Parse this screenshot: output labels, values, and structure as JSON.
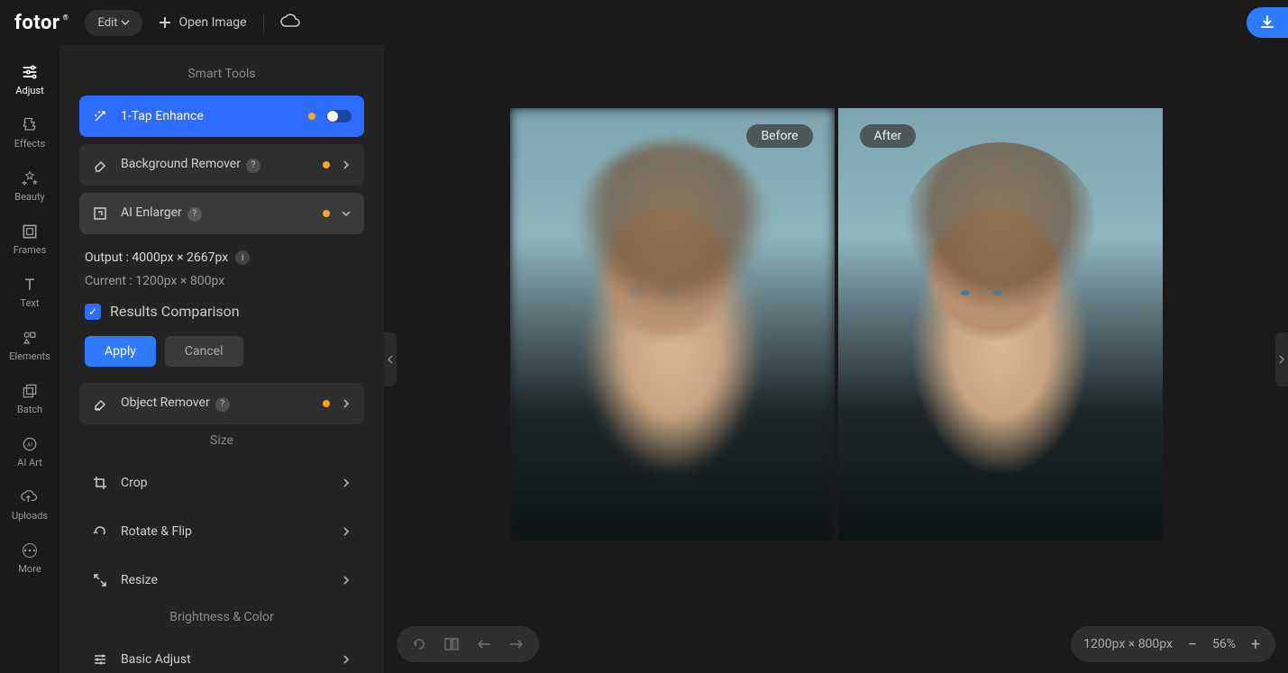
{
  "header": {
    "logo_text": "fotor",
    "edit_label": "Edit",
    "open_image_label": "Open Image"
  },
  "nav": {
    "items": [
      {
        "label": "Adjust"
      },
      {
        "label": "Effects"
      },
      {
        "label": "Beauty"
      },
      {
        "label": "Frames"
      },
      {
        "label": "Text"
      },
      {
        "label": "Elements"
      },
      {
        "label": "Batch"
      },
      {
        "label": "AI Art"
      },
      {
        "label": "Uploads"
      },
      {
        "label": "More"
      }
    ]
  },
  "panel": {
    "smart_tools_title": "Smart Tools",
    "tools": {
      "tap_enhance": "1-Tap Enhance",
      "bg_remover": "Background Remover",
      "ai_enlarger": "AI Enlarger",
      "object_remover": "Object Remover"
    },
    "enlarger": {
      "output_label": "Output : 4000px × 2667px",
      "current_label": "Current : 1200px × 800px",
      "results_comparison": "Results Comparison",
      "apply": "Apply",
      "cancel": "Cancel"
    },
    "size_title": "Size",
    "size_items": {
      "crop": "Crop",
      "rotate": "Rotate & Flip",
      "resize": "Resize"
    },
    "brightness_title": "Brightness & Color",
    "basic_adjust": "Basic Adjust"
  },
  "canvas": {
    "before_label": "Before",
    "after_label": "After"
  },
  "footer": {
    "dimensions": "1200px × 800px",
    "zoom": "56%"
  }
}
